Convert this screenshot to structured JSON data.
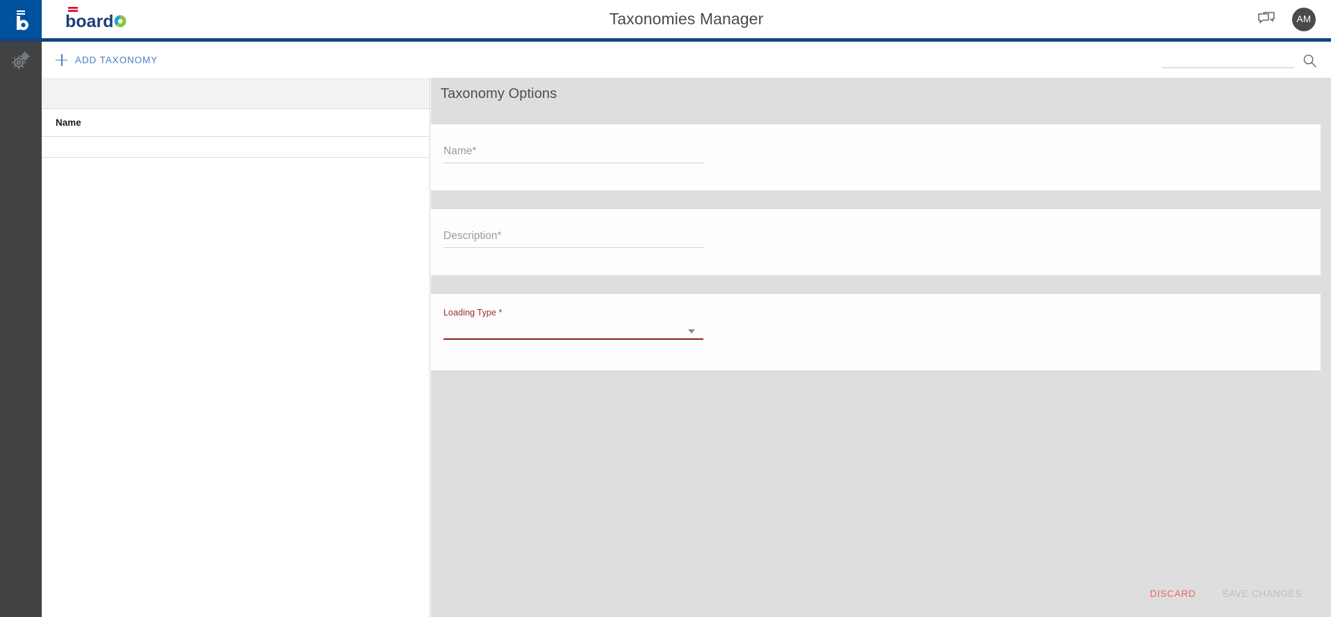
{
  "app": {
    "title": "Taxonomies Manager",
    "brand_name": "board",
    "accent_blue": "#13447e",
    "rail_blue": "#00519e",
    "rail_gray": "#424242",
    "error_red": "#8b1f1f",
    "discard_red": "#f0635c",
    "link_blue": "#4a7fc1"
  },
  "rail": {
    "logo_icon": "board-b-logo-icon",
    "items": [
      {
        "name": "settings-gears",
        "icon": "gears-icon"
      }
    ]
  },
  "header": {
    "chat_icon": "chat-bubbles-icon",
    "avatar_initials": "AM"
  },
  "toolbar": {
    "add_label": "ADD TAXONOMY",
    "add_icon": "plus-icon",
    "search_placeholder": "",
    "search_value": "",
    "search_icon": "search-icon"
  },
  "list": {
    "columns": [
      "Name"
    ],
    "rows": []
  },
  "detail": {
    "title": "Taxonomy Options",
    "fields": [
      {
        "key": "name",
        "label": "Name",
        "required_mark": "*",
        "value": "",
        "placeholder": "",
        "state": "normal"
      },
      {
        "key": "description",
        "label": "Description",
        "required_mark": "*",
        "value": "",
        "placeholder": "",
        "state": "normal"
      },
      {
        "key": "loading_type",
        "label": "Loading Type *",
        "required_mark": "*",
        "value": "",
        "placeholder": "",
        "state": "error",
        "control": "dropdown",
        "caret_icon": "chevron-down-icon"
      }
    ],
    "actions": {
      "discard_label": "DISCARD",
      "save_label": "SAVE CHANGES",
      "save_enabled": false
    }
  }
}
